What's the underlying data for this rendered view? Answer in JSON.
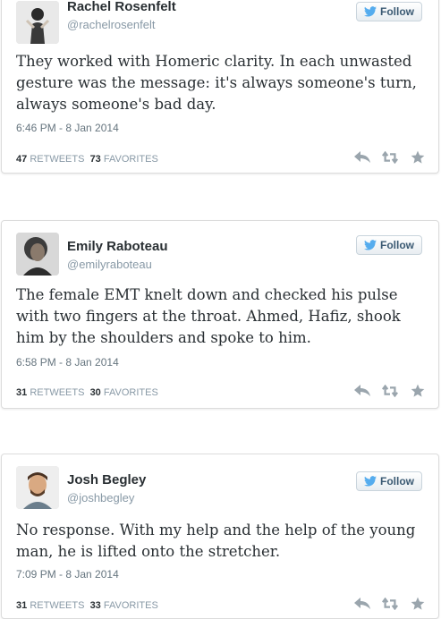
{
  "follow_label": "Follow",
  "colors": {
    "text": "#292f33",
    "muted": "#8899a6",
    "twitter_blue": "#55acee",
    "icon": "#9aa5ad"
  },
  "tweets": [
    {
      "name": "Rachel Rosenfelt",
      "handle": "@rachelrosenfelt",
      "text": "They worked with Homeric clarity. In each unwasted gesture was the message: it's always someone's turn, always someone's bad day.",
      "timestamp": "6:46 PM - 8 Jan 2014",
      "retweets": "47",
      "retweets_label": "RETWEETS",
      "favorites": "73",
      "favorites_label": "FAVORITES"
    },
    {
      "name": "Emily Raboteau",
      "handle": "@emilyraboteau",
      "text": "The female EMT knelt down and checked his pulse with two fingers at the throat. Ahmed, Hafiz, shook him by the shoulders and spoke to him.",
      "timestamp": "6:58 PM - 8 Jan 2014",
      "retweets": "31",
      "retweets_label": "RETWEETS",
      "favorites": "30",
      "favorites_label": "FAVORITES"
    },
    {
      "name": "Josh Begley",
      "handle": "@joshbegley",
      "text": "No response. With my help and the help of the young man, he is lifted onto the stretcher.",
      "timestamp": "7:09 PM - 8 Jan 2014",
      "retweets": "31",
      "retweets_label": "RETWEETS",
      "favorites": "33",
      "favorites_label": "FAVORITES"
    }
  ]
}
